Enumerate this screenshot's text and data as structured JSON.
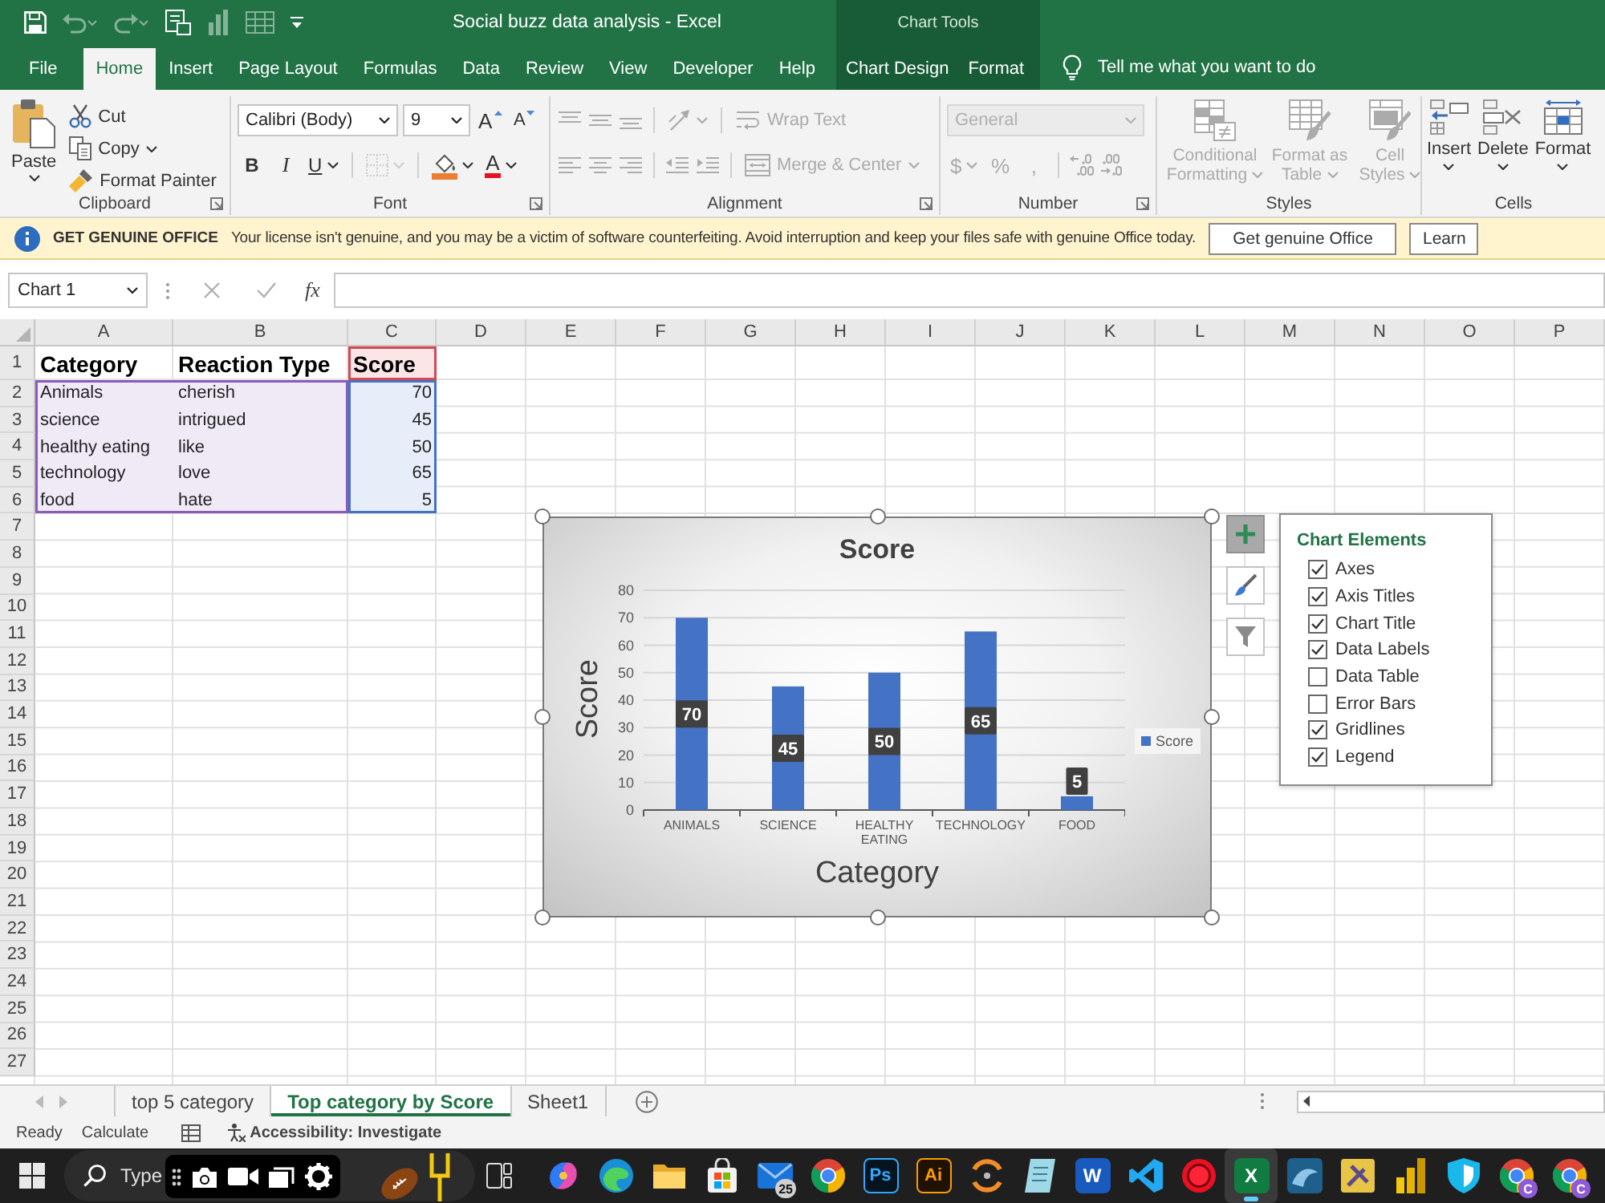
{
  "title_bar": {
    "title": "Social buzz data analysis - Excel",
    "quick_access": [
      {
        "kind": "save",
        "disabled": false
      },
      {
        "kind": "undo",
        "disabled": true
      },
      {
        "kind": "redo",
        "disabled": true
      },
      {
        "kind": "form",
        "disabled": false
      },
      {
        "kind": "chart",
        "disabled": true
      },
      {
        "kind": "table",
        "disabled": true
      },
      {
        "kind": "customize",
        "disabled": false
      }
    ]
  },
  "tabs": [
    {
      "label": "File",
      "selected": false
    },
    {
      "label": "Home",
      "selected": true
    },
    {
      "label": "Insert",
      "selected": false
    },
    {
      "label": "Page Layout",
      "selected": false
    },
    {
      "label": "Formulas",
      "selected": false
    },
    {
      "label": "Data",
      "selected": false
    },
    {
      "label": "Review",
      "selected": false
    },
    {
      "label": "View",
      "selected": false
    },
    {
      "label": "Developer",
      "selected": false
    },
    {
      "label": "Help",
      "selected": false
    }
  ],
  "contextual": {
    "title": "Chart Tools",
    "tabs": [
      {
        "label": "Chart Design",
        "selected": false
      },
      {
        "label": "Format",
        "selected": false
      }
    ]
  },
  "tell_me": {
    "placeholder": "Tell me what you want to do"
  },
  "ribbon": {
    "groups": [
      {
        "kind": "clipboard",
        "label": "Clipboard",
        "launcher": true,
        "disabled": false,
        "paste": "Paste",
        "commands": [
          {
            "label": "Cut",
            "dropdown": false
          },
          {
            "label": "Copy",
            "dropdown": true
          },
          {
            "label": "Format Painter",
            "dropdown": false
          }
        ]
      },
      {
        "kind": "font",
        "label": "Font",
        "launcher": true,
        "disabled": false,
        "font_name": "Calibri (Body)",
        "font_size": "9",
        "size_buttons": [
          "A",
          "A"
        ],
        "styles": [
          "B",
          "I",
          "U"
        ],
        "borders": {
          "disabled": true
        },
        "font_color_letter": "A"
      },
      {
        "kind": "alignment",
        "label": "Alignment",
        "launcher": true,
        "disabled": true,
        "wrap": "Wrap Text",
        "merge": "Merge & Center"
      },
      {
        "kind": "number",
        "label": "Number",
        "launcher": true,
        "disabled": true,
        "format": "General",
        "symbols": [
          "$",
          "%",
          ","
        ]
      },
      {
        "kind": "styles",
        "label": "Styles",
        "launcher": false,
        "disabled": true,
        "buttons": [
          "Conditional Formatting",
          "Format as Table",
          "Cell Styles"
        ]
      },
      {
        "kind": "cells",
        "label": "Cells",
        "launcher": false,
        "disabled": false,
        "buttons": [
          "Insert",
          "Delete",
          "Format"
        ]
      }
    ]
  },
  "message_bar": {
    "title": "GET GENUINE OFFICE",
    "text": "Your license isn't genuine, and you may be a victim of software counterfeiting. Avoid interruption and keep your files safe with genuine Office today.",
    "buttons": [
      "Get genuine Office",
      "Learn"
    ]
  },
  "formula_bar": {
    "name_box": "Chart 1",
    "function_button": "fx"
  },
  "sheet": {
    "columns": [
      "A",
      "B",
      "C",
      "D",
      "E",
      "F",
      "G",
      "H",
      "I",
      "J",
      "K",
      "L",
      "M",
      "N",
      "O",
      "P"
    ],
    "rows": [
      {
        "number": "1",
        "kind": "header",
        "cells": [
          {
            "text": "Category",
            "kind": "plain"
          },
          {
            "text": "Reaction Type",
            "kind": "plain"
          },
          {
            "text": "Score",
            "kind": "series-name"
          }
        ]
      },
      {
        "number": "2",
        "kind": "normal",
        "cells": [
          {
            "text": "Animals",
            "kind": "category"
          },
          {
            "text": "cherish",
            "kind": "category"
          },
          {
            "text": "70",
            "kind": "value"
          }
        ]
      },
      {
        "number": "3",
        "kind": "normal",
        "cells": [
          {
            "text": "science",
            "kind": "category"
          },
          {
            "text": "intrigued",
            "kind": "category"
          },
          {
            "text": "45",
            "kind": "value"
          }
        ]
      },
      {
        "number": "4",
        "kind": "normal",
        "cells": [
          {
            "text": "healthy eating",
            "kind": "category"
          },
          {
            "text": "like",
            "kind": "category"
          },
          {
            "text": "50",
            "kind": "value"
          }
        ]
      },
      {
        "number": "5",
        "kind": "normal",
        "cells": [
          {
            "text": "technology",
            "kind": "category"
          },
          {
            "text": "love",
            "kind": "category"
          },
          {
            "text": "65",
            "kind": "value"
          }
        ]
      },
      {
        "number": "6",
        "kind": "normal",
        "cells": [
          {
            "text": "food",
            "kind": "category"
          },
          {
            "text": "hate",
            "kind": "category"
          },
          {
            "text": "5",
            "kind": "value"
          }
        ]
      },
      {
        "number": "7",
        "kind": "normal"
      },
      {
        "number": "8",
        "kind": "normal"
      },
      {
        "number": "9",
        "kind": "normal"
      },
      {
        "number": "10",
        "kind": "normal"
      },
      {
        "number": "11",
        "kind": "normal"
      },
      {
        "number": "12",
        "kind": "normal"
      },
      {
        "number": "13",
        "kind": "normal"
      },
      {
        "number": "14",
        "kind": "normal"
      },
      {
        "number": "15",
        "kind": "normal"
      },
      {
        "number": "16",
        "kind": "normal"
      },
      {
        "number": "17",
        "kind": "normal"
      },
      {
        "number": "18",
        "kind": "normal"
      },
      {
        "number": "19",
        "kind": "normal"
      },
      {
        "number": "20",
        "kind": "normal"
      },
      {
        "number": "21",
        "kind": "normal"
      },
      {
        "number": "22",
        "kind": "normal"
      },
      {
        "number": "23",
        "kind": "normal"
      },
      {
        "number": "24",
        "kind": "normal"
      },
      {
        "number": "25",
        "kind": "normal"
      },
      {
        "number": "26",
        "kind": "normal"
      },
      {
        "number": "27",
        "kind": "normal"
      }
    ]
  },
  "chart": {
    "selected": true,
    "chart_data": {
      "type": "bar",
      "title": "Score",
      "xlabel": "Category",
      "ylabel": "Score",
      "categories": [
        "ANIMALS",
        "SCIENCE",
        "HEALTHY EATING",
        "TECHNOLOGY",
        "FOOD"
      ],
      "series": [
        {
          "name": "Score",
          "color": "#4472c4",
          "values": [
            70,
            45,
            50,
            65,
            5
          ]
        }
      ],
      "ylim": [
        0,
        80
      ],
      "yticks": [
        0,
        10,
        20,
        30,
        40,
        50,
        60,
        70,
        80
      ],
      "grid": true,
      "data_labels": true
    }
  },
  "chart_buttons": [
    {
      "kind": "elements",
      "selected": true
    },
    {
      "kind": "styles",
      "selected": false
    },
    {
      "kind": "filters",
      "selected": false
    }
  ],
  "chart_elements": {
    "title": "Chart Elements",
    "items": [
      {
        "label": "Axes",
        "checked": true
      },
      {
        "label": "Axis Titles",
        "checked": true
      },
      {
        "label": "Chart Title",
        "checked": true
      },
      {
        "label": "Data Labels",
        "checked": true
      },
      {
        "label": "Data Table",
        "checked": false
      },
      {
        "label": "Error Bars",
        "checked": false
      },
      {
        "label": "Gridlines",
        "checked": true
      },
      {
        "label": "Legend",
        "checked": true
      }
    ]
  },
  "sheet_tabs": [
    {
      "label": "top 5 category",
      "selected": false
    },
    {
      "label": "Top category by Score",
      "selected": true
    },
    {
      "label": "Sheet1",
      "selected": false
    }
  ],
  "status_bar": {
    "items": [
      {
        "label": "Ready",
        "kind": "text"
      },
      {
        "label": "Calculate",
        "kind": "button"
      }
    ],
    "accessibility": "Accessibility: Investigate"
  },
  "taskbar": {
    "search": {
      "placeholder": "Type"
    },
    "apps": [
      {
        "kind": "swirl",
        "selected": false
      },
      {
        "kind": "wave",
        "selected": false
      },
      {
        "kind": "folder",
        "selected": false
      },
      {
        "kind": "bag",
        "selected": false
      },
      {
        "kind": "mail",
        "badge": "25",
        "selected": false
      },
      {
        "kind": "ring",
        "selected": false
      },
      {
        "kind": "tile-dark",
        "label": "Ps",
        "color": "#31a8ff",
        "selected": false
      },
      {
        "kind": "tile-dark",
        "label": "Ai",
        "color": "#ff9a00",
        "selected": false
      },
      {
        "kind": "arc",
        "selected": false
      },
      {
        "kind": "note",
        "selected": false
      },
      {
        "kind": "tile-solid",
        "label": "W",
        "color": "#185abd",
        "selected": false
      },
      {
        "kind": "code",
        "selected": false
      },
      {
        "kind": "record",
        "selected": false
      },
      {
        "kind": "tile-solid",
        "label": "X",
        "color": "#107c41",
        "selected": true
      },
      {
        "kind": "fin",
        "selected": false
      },
      {
        "kind": "tools",
        "selected": false
      },
      {
        "kind": "bars",
        "selected": false
      },
      {
        "kind": "shield",
        "selected": false
      },
      {
        "kind": "ring",
        "badge": "C",
        "selected": false
      },
      {
        "kind": "ring",
        "badge": "C",
        "selected": false
      }
    ]
  }
}
